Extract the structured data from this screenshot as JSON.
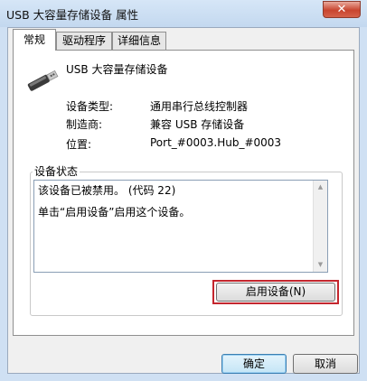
{
  "window": {
    "title": "USB 大容量存储设备 属性",
    "close_label": "✕"
  },
  "tabs": [
    {
      "label": "常规"
    },
    {
      "label": "驱动程序"
    },
    {
      "label": "详细信息"
    }
  ],
  "device": {
    "name": "USB 大容量存储设备"
  },
  "properties": [
    {
      "label": "设备类型:",
      "value": "通用串行总线控制器"
    },
    {
      "label": "制造商:",
      "value": "兼容 USB 存储设备"
    },
    {
      "label": "位置:",
      "value": "Port_#0003.Hub_#0003"
    }
  ],
  "status": {
    "group_label": "设备状态",
    "lines": [
      "该设备已被禁用。 (代码 22)",
      "单击“启用设备”启用这个设备。"
    ]
  },
  "buttons": {
    "enable": "启用设备(N)",
    "ok": "确定",
    "cancel": "取消"
  },
  "icons": {
    "scroll_up": "▲",
    "scroll_down": "▼"
  }
}
